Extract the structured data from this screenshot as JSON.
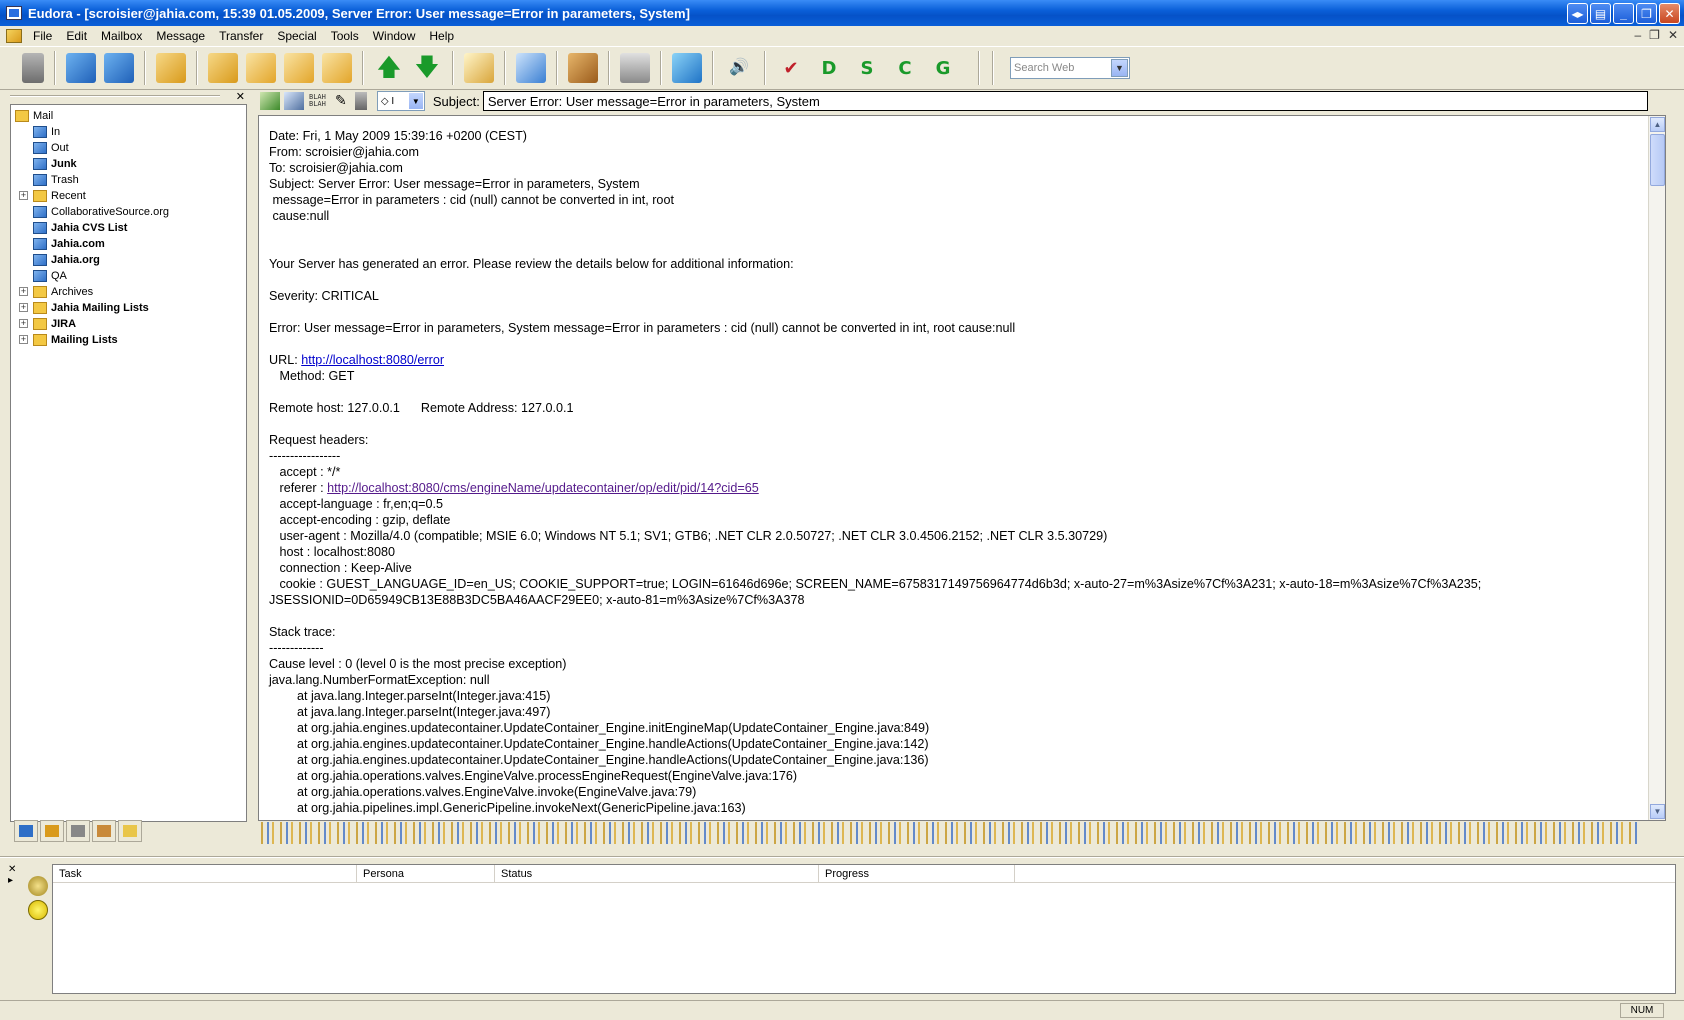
{
  "window": {
    "title": "Eudora - [scroisier@jahia.com, 15:39 01.05.2009, Server Error: User message=Error in parameters, System]"
  },
  "menu": [
    "File",
    "Edit",
    "Mailbox",
    "Message",
    "Transfer",
    "Special",
    "Tools",
    "Window",
    "Help"
  ],
  "toolbar": {
    "letters": [
      "D",
      "S",
      "C",
      "G"
    ],
    "search_placeholder": "Search Web"
  },
  "mailboxes": {
    "root": "Mail",
    "items": [
      {
        "label": "In",
        "bold": false,
        "expand": false
      },
      {
        "label": "Out",
        "bold": false,
        "expand": false
      },
      {
        "label": "Junk",
        "bold": true,
        "expand": false
      },
      {
        "label": "Trash",
        "bold": false,
        "expand": false
      },
      {
        "label": "Recent",
        "bold": false,
        "expand": true
      },
      {
        "label": "CollaborativeSource.org",
        "bold": false,
        "expand": false
      },
      {
        "label": "Jahia CVS List",
        "bold": true,
        "expand": false
      },
      {
        "label": "Jahia.com",
        "bold": true,
        "expand": false
      },
      {
        "label": "Jahia.org",
        "bold": true,
        "expand": false
      },
      {
        "label": "QA",
        "bold": false,
        "expand": false
      },
      {
        "label": "Archives",
        "bold": false,
        "expand": true
      },
      {
        "label": "Jahia Mailing Lists",
        "bold": true,
        "expand": true
      },
      {
        "label": "JIRA",
        "bold": true,
        "expand": true
      },
      {
        "label": "Mailing Lists",
        "bold": true,
        "expand": true
      }
    ]
  },
  "message_toolbar": {
    "blah_label": "BLAH",
    "priority_value": "◇ I",
    "subject_label": "Subject:",
    "subject_value": "Server Error: User message=Error in parameters, System"
  },
  "message": {
    "header_lines": [
      "Date: Fri, 1 May 2009 15:39:16 +0200 (CEST)",
      "From: scroisier@jahia.com",
      "To: scroisier@jahia.com",
      "Subject: Server Error: User message=Error in parameters, System",
      " message=Error in parameters : cid (null) cannot be converted in int, root",
      " cause:null"
    ],
    "intro": "Your Server has generated an error. Please review the details below for additional information:",
    "severity": "Severity: CRITICAL",
    "error": "Error: User message=Error in parameters, System message=Error in parameters : cid (null) cannot be converted in int, root cause:null",
    "url_label": "URL: ",
    "url": "http://localhost:8080/error",
    "method": "   Method: GET",
    "remote": "Remote host: 127.0.0.1      Remote Address: 127.0.0.1",
    "request_headers_title": "Request headers:",
    "request_headers_rule": "-----------------",
    "accept": "   accept : */*",
    "referer_label": "   referer : ",
    "referer_url": "http://localhost:8080/cms/engineName/updatecontainer/op/edit/pid/14?cid=65",
    "header_rest": [
      "   accept-language : fr,en;q=0.5",
      "   accept-encoding : gzip, deflate",
      "   user-agent : Mozilla/4.0 (compatible; MSIE 6.0; Windows NT 5.1; SV1; GTB6; .NET CLR 2.0.50727; .NET CLR 3.0.4506.2152; .NET CLR 3.5.30729)",
      "   host : localhost:8080",
      "   connection : Keep-Alive",
      "   cookie : GUEST_LANGUAGE_ID=en_US; COOKIE_SUPPORT=true; LOGIN=61646d696e; SCREEN_NAME=6758317149756964774d6b3d; x-auto-27=m%3Asize%7Cf%3A231; x-auto-18=m%3Asize%7Cf%3A235;",
      "JSESSIONID=0D65949CB13E88B3DC5BA46AACF29EE0; x-auto-81=m%3Asize%7Cf%3A378"
    ],
    "stack_title": "Stack trace:",
    "stack_rule": "-------------",
    "stack_lines": [
      "Cause level : 0 (level 0 is the most precise exception)",
      "java.lang.NumberFormatException: null",
      "        at java.lang.Integer.parseInt(Integer.java:415)",
      "        at java.lang.Integer.parseInt(Integer.java:497)",
      "        at org.jahia.engines.updatecontainer.UpdateContainer_Engine.initEngineMap(UpdateContainer_Engine.java:849)",
      "        at org.jahia.engines.updatecontainer.UpdateContainer_Engine.handleActions(UpdateContainer_Engine.java:142)",
      "        at org.jahia.engines.updatecontainer.UpdateContainer_Engine.handleActions(UpdateContainer_Engine.java:136)",
      "        at org.jahia.operations.valves.EngineValve.processEngineRequest(EngineValve.java:176)",
      "        at org.jahia.operations.valves.EngineValve.invoke(EngineValve.java:79)",
      "        at org.jahia.pipelines.impl.GenericPipeline.invokeNext(GenericPipeline.java:163)"
    ]
  },
  "tasks": {
    "columns": [
      "Task",
      "Persona",
      "Status",
      "Progress"
    ]
  },
  "status": {
    "num": "NUM"
  },
  "colors": {
    "titlebar": "#0a5fd8",
    "link": "#0000cc",
    "visited_link": "#551a8b",
    "chrome": "#ece9d8"
  }
}
